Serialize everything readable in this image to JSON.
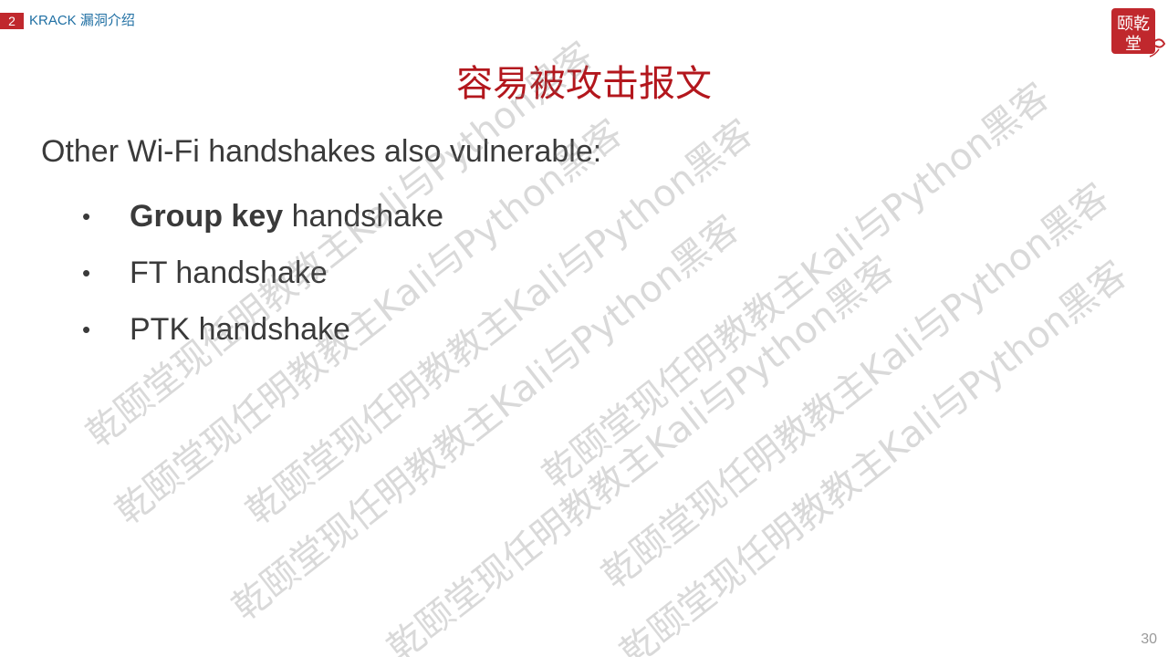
{
  "header": {
    "section_number": "2",
    "section_label": "KRACK 漏洞介绍"
  },
  "seal": {
    "text_top": "颐乾",
    "text_bottom": "堂",
    "color": "#c0282d"
  },
  "title": "容易被攻击报文",
  "intro": "Other Wi-Fi handshakes also vulnerable:",
  "bullets": [
    {
      "bold": "Group key",
      "rest": " handshake"
    },
    {
      "bold": "",
      "rest": "FT handshake"
    },
    {
      "bold": "",
      "rest": "PTK handshake"
    }
  ],
  "page_number": "30",
  "watermark": {
    "text": "乾颐堂现任明教教主Kali与Python黑客"
  },
  "colors": {
    "accent_red": "#c0282d",
    "title_red": "#b3171d",
    "label_blue": "#1f6fa3",
    "body_text": "#3a3a3a"
  }
}
